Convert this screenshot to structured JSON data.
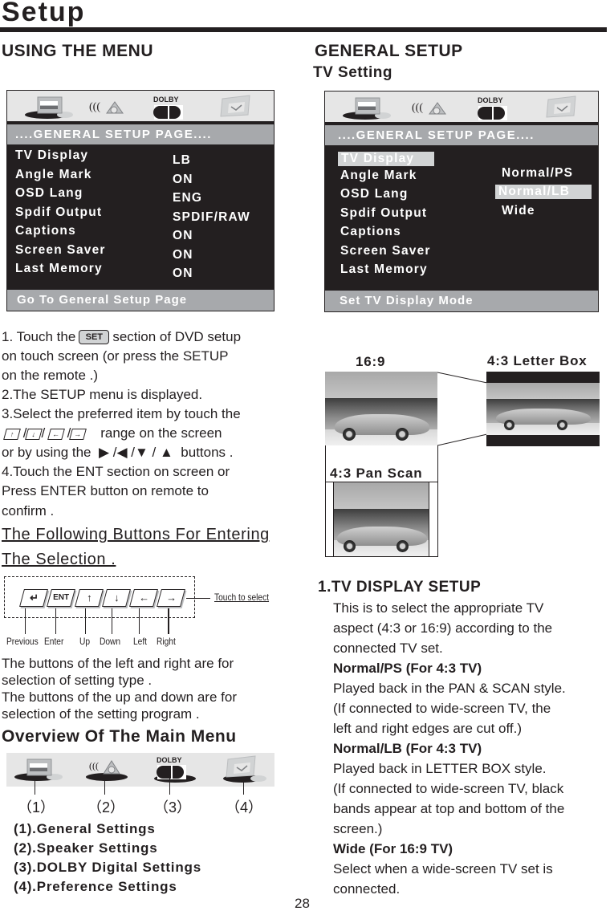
{
  "page": {
    "title": "Setup",
    "page_number": "28"
  },
  "left": {
    "heading": "USING THE MENU",
    "menu_panel": {
      "icons": [
        "general-settings-icon",
        "speaker-settings-icon",
        "dolby-digital-icon",
        "preference-settings-icon"
      ],
      "dolby_label": "DOLBY",
      "header": "....GENERAL SETUP PAGE....",
      "items": [
        {
          "label": "TV Display",
          "value": "LB"
        },
        {
          "label": "Angle Mark",
          "value": "ON"
        },
        {
          "label": "OSD Lang",
          "value": "ENG"
        },
        {
          "label": "Spdif Output",
          "value": "SPDIF/RAW"
        },
        {
          "label": "Captions",
          "value": "ON"
        },
        {
          "label": "Screen Saver",
          "value": "ON"
        },
        {
          "label": "Last Memory",
          "value": "ON"
        }
      ],
      "footer": "Go To General Setup Page"
    },
    "steps": {
      "s1_a": "1. Touch the",
      "set_key": "SET",
      "s1_b": "section of DVD setup",
      "s1_c": "on touch screen (or press the SETUP",
      "s1_d": "on the remote .)",
      "s2": "2.The SETUP menu is displayed.",
      "s3_a": "3.Select the preferred item by touch the",
      "s3_keys": [
        "↑",
        "↓",
        "←",
        "→"
      ],
      "s3_b": "range on the screen",
      "s3_c_pre": "or by using the",
      "s3_c_arrows": "▶ /◀  /▼ / ▲",
      "s3_c_post": "buttons .",
      "s4_a": "4.Touch the ENT section on screen or",
      "s4_b": "Press ENTER button on remote to",
      "s4_c": "confirm ."
    },
    "buttons_heading_1": "The Following Buttons For Entering",
    "buttons_heading_2": "The  Selection .",
    "touch_buttons": [
      {
        "glyph": "↵",
        "label": "Previous"
      },
      {
        "glyph": "ENT",
        "label": "Enter"
      },
      {
        "glyph": "↑",
        "label": "Up"
      },
      {
        "glyph": "↓",
        "label": "Down"
      },
      {
        "glyph": "←",
        "label": "Left"
      },
      {
        "glyph": "→",
        "label": "Right"
      }
    ],
    "touch_hint": "Touch to select",
    "notes": [
      "The buttons of the left and right are for",
      "selection of setting type .",
      "The buttons of the up and down are for",
      "selection of the setting program ."
    ],
    "overview_heading": "Overview Of The Main Menu",
    "overview_markers": [
      "（1）",
      "（2）",
      "（3）",
      "（4）"
    ],
    "overview_items": [
      "(1).General Settings",
      "(2).Speaker Settings",
      "(3).DOLBY Digital Settings",
      "(4).Preference Settings"
    ]
  },
  "right": {
    "heading": "GENERAL SETUP",
    "subheading": "TV Setting",
    "menu_panel": {
      "header": "....GENERAL SETUP PAGE....",
      "items": [
        "TV Display",
        "Angle Mark",
        "OSD Lang",
        "Spdif Output",
        "Captions",
        "Screen Saver",
        "Last Memory"
      ],
      "selected_item": "TV Display",
      "options": [
        "Normal/PS",
        "Normal/LB",
        "Wide"
      ],
      "selected_option": "Normal/LB",
      "footer": "Set TV Display Mode"
    },
    "aspect_images": {
      "wide": "16:9",
      "letterbox": "4:3 Letter Box",
      "panscan": "4:3 Pan Scan"
    },
    "tv_display_setup": {
      "heading": "1.TV DISPLAY SETUP",
      "intro": [
        "This is to select the appropriate TV",
        "aspect (4:3 or 16:9) according to the",
        "connected TV set."
      ],
      "ps_title": "Normal/PS (For 4:3 TV)",
      "ps_text": [
        "Played back in the PAN & SCAN style.",
        "(If connected to wide-screen TV, the",
        "left and right edges are cut off.)"
      ],
      "lb_title": "Normal/LB (For 4:3 TV)",
      "lb_text": [
        "Played back in LETTER BOX style.",
        "(If connected to wide-screen TV, black",
        "bands appear at top and bottom of the",
        "screen.)"
      ],
      "wide_title": "Wide (For 16:9 TV)",
      "wide_text": [
        "Select when a wide-screen TV set is",
        "connected."
      ]
    }
  }
}
